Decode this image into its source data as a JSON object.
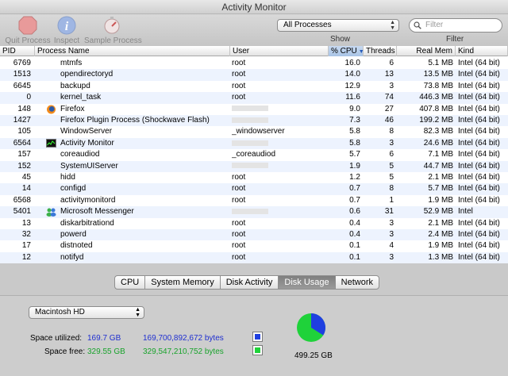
{
  "window": {
    "title": "Activity Monitor"
  },
  "toolbar": {
    "quit_label": "Quit Process",
    "inspect_label": "Inspect",
    "sample_label": "Sample Process",
    "process_filter_value": "All Processes",
    "show_label": "Show",
    "search_placeholder": "Filter",
    "filter_label": "Filter"
  },
  "table": {
    "headers": {
      "pid": "PID",
      "name": "Process Name",
      "user": "User",
      "cpu": "% CPU",
      "threads": "Threads",
      "mem": "Real Mem",
      "kind": "Kind"
    },
    "rows": [
      {
        "pid": "6769",
        "name": "mtmfs",
        "user": "root",
        "cpu": "16.0",
        "threads": "6",
        "mem": "5.1 MB",
        "kind": "Intel (64 bit)"
      },
      {
        "pid": "1513",
        "name": "opendirectoryd",
        "user": "root",
        "cpu": "14.0",
        "threads": "13",
        "mem": "13.5 MB",
        "kind": "Intel (64 bit)"
      },
      {
        "pid": "6645",
        "name": "backupd",
        "user": "root",
        "cpu": "12.9",
        "threads": "3",
        "mem": "73.8 MB",
        "kind": "Intel (64 bit)"
      },
      {
        "pid": "0",
        "name": "kernel_task",
        "user": "root",
        "cpu": "11.6",
        "threads": "74",
        "mem": "446.3 MB",
        "kind": "Intel (64 bit)"
      },
      {
        "pid": "148",
        "name": "Firefox",
        "user": "",
        "cpu": "9.0",
        "threads": "27",
        "mem": "407.8 MB",
        "kind": "Intel (64 bit)",
        "icon": "firefox-icon"
      },
      {
        "pid": "1427",
        "name": "Firefox Plugin Process (Shockwave Flash)",
        "user": "",
        "cpu": "7.3",
        "threads": "46",
        "mem": "199.2 MB",
        "kind": "Intel (64 bit)"
      },
      {
        "pid": "105",
        "name": "WindowServer",
        "user": "_windowserver",
        "cpu": "5.8",
        "threads": "8",
        "mem": "82.3 MB",
        "kind": "Intel (64 bit)"
      },
      {
        "pid": "6564",
        "name": "Activity Monitor",
        "user": "",
        "cpu": "5.8",
        "threads": "3",
        "mem": "24.6 MB",
        "kind": "Intel (64 bit)",
        "icon": "activity-monitor-icon"
      },
      {
        "pid": "157",
        "name": "coreaudiod",
        "user": "_coreaudiod",
        "cpu": "5.7",
        "threads": "6",
        "mem": "7.1 MB",
        "kind": "Intel (64 bit)"
      },
      {
        "pid": "152",
        "name": "SystemUIServer",
        "user": "",
        "cpu": "1.9",
        "threads": "5",
        "mem": "44.7 MB",
        "kind": "Intel (64 bit)"
      },
      {
        "pid": "45",
        "name": "hidd",
        "user": "root",
        "cpu": "1.2",
        "threads": "5",
        "mem": "2.1 MB",
        "kind": "Intel (64 bit)"
      },
      {
        "pid": "14",
        "name": "configd",
        "user": "root",
        "cpu": "0.7",
        "threads": "8",
        "mem": "5.7 MB",
        "kind": "Intel (64 bit)"
      },
      {
        "pid": "6568",
        "name": "activitymonitord",
        "user": "root",
        "cpu": "0.7",
        "threads": "1",
        "mem": "1.9 MB",
        "kind": "Intel (64 bit)"
      },
      {
        "pid": "5401",
        "name": "Microsoft Messenger",
        "user": "",
        "cpu": "0.6",
        "threads": "31",
        "mem": "52.9 MB",
        "kind": "Intel",
        "icon": "messenger-icon"
      },
      {
        "pid": "13",
        "name": "diskarbitrationd",
        "user": "root",
        "cpu": "0.4",
        "threads": "3",
        "mem": "2.1 MB",
        "kind": "Intel (64 bit)"
      },
      {
        "pid": "32",
        "name": "powerd",
        "user": "root",
        "cpu": "0.4",
        "threads": "3",
        "mem": "2.4 MB",
        "kind": "Intel (64 bit)"
      },
      {
        "pid": "17",
        "name": "distnoted",
        "user": "root",
        "cpu": "0.1",
        "threads": "4",
        "mem": "1.9 MB",
        "kind": "Intel (64 bit)"
      },
      {
        "pid": "12",
        "name": "notifyd",
        "user": "root",
        "cpu": "0.1",
        "threads": "3",
        "mem": "1.3 MB",
        "kind": "Intel (64 bit)"
      }
    ]
  },
  "tabs": [
    "CPU",
    "System Memory",
    "Disk Activity",
    "Disk Usage",
    "Network"
  ],
  "active_tab": "Disk Usage",
  "disk": {
    "volume": "Macintosh HD",
    "utilized_label": "Space utilized:",
    "utilized_gb": "169.7 GB",
    "utilized_bytes": "169,700,892,672 bytes",
    "free_label": "Space free:",
    "free_gb": "329.55 GB",
    "free_bytes": "329,547,210,752 bytes",
    "total": "499.25 GB",
    "used_fraction": 0.34,
    "used_color": "#1f3fe0",
    "free_color": "#1fd23a"
  }
}
